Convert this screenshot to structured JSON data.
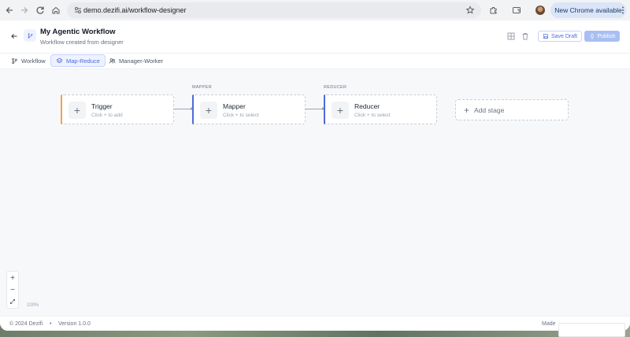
{
  "browser": {
    "url": "demo.dezifi.ai/workflow-designer",
    "update_label": "New Chrome available"
  },
  "header": {
    "title": "My Agentic Workflow",
    "subtitle": "Workflow created from designer",
    "save_label": "Save Draft",
    "publish_label": "Publish"
  },
  "tabs": [
    {
      "label": "Workflow"
    },
    {
      "label": "Map-Reduce"
    },
    {
      "label": "Manager-Worker"
    }
  ],
  "canvas": {
    "stage_labels": [
      "MAPPER",
      "REDUCER"
    ],
    "nodes": [
      {
        "title": "Trigger",
        "hint": "Click + to add"
      },
      {
        "title": "Mapper",
        "hint": "Click + to select"
      },
      {
        "title": "Reducer",
        "hint": "Click + to select"
      }
    ],
    "add_stage_label": "Add stage",
    "zoom_level": "100%"
  },
  "footer": {
    "copyright": "© 2024 Dezifi",
    "separator": "•",
    "version": "Version 1.0.0",
    "made_with": "Made"
  },
  "colors": {
    "accent": "#4f6bd8",
    "trigger_bar": "#f0a24b",
    "stage_bar": "#4f6bd8"
  }
}
